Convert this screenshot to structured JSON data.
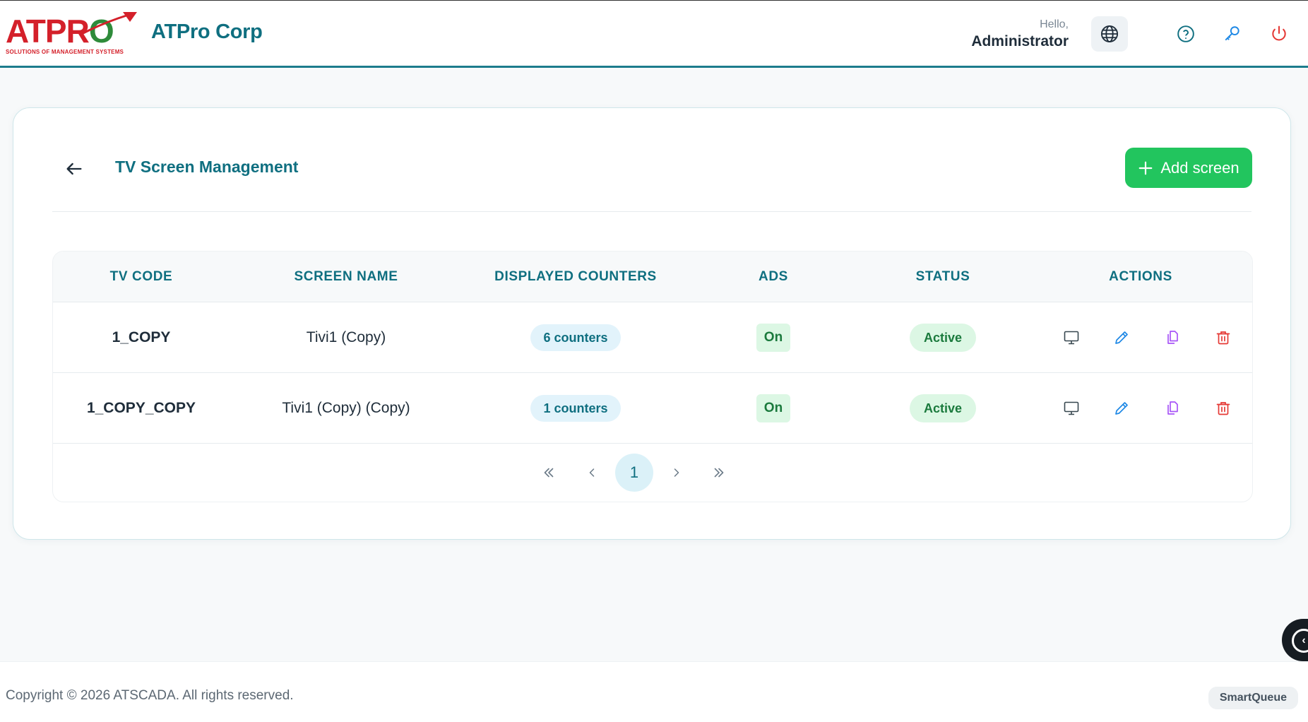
{
  "header": {
    "logo_text_red": "ATPR",
    "logo_text_green": "O",
    "logo_tagline": "SOLUTIONS OF MANAGEMENT SYSTEMS",
    "brand_name": "ATPro Corp",
    "greeting": "Hello,",
    "user_name": "Administrator",
    "icons": [
      "globe-icon",
      "help-icon",
      "key-icon",
      "power-icon"
    ]
  },
  "page": {
    "title": "TV Screen Management",
    "add_button_label": "Add screen"
  },
  "table": {
    "columns": [
      "TV CODE",
      "SCREEN NAME",
      "DISPLAYED COUNTERS",
      "ADS",
      "STATUS",
      "ACTIONS"
    ],
    "rows": [
      {
        "tv_code": "1_COPY",
        "screen_name": "Tivi1 (Copy)",
        "counters": "6 counters",
        "ads": "On",
        "status": "Active"
      },
      {
        "tv_code": "1_COPY_COPY",
        "screen_name": "Tivi1 (Copy) (Copy)",
        "counters": "1 counters",
        "ads": "On",
        "status": "Active"
      }
    ],
    "action_icons": [
      "monitor-icon",
      "edit-icon",
      "copy-icon",
      "delete-icon"
    ]
  },
  "pagination": {
    "current_page": "1",
    "icons": [
      "first-page-icon",
      "prev-page-icon",
      "next-page-icon",
      "last-page-icon"
    ]
  },
  "footer": {
    "copyright": "Copyright © 2026 ATSCADA. All rights reserved.",
    "product": "SmartQueue"
  },
  "colors": {
    "brand_teal": "#0f6f80",
    "primary_green": "#22c55e",
    "logo_red": "#d4202a",
    "logo_green": "#2e8b3a",
    "danger_red": "#e53935",
    "copy_purple": "#a855f7",
    "edit_blue": "#1e88e5"
  }
}
